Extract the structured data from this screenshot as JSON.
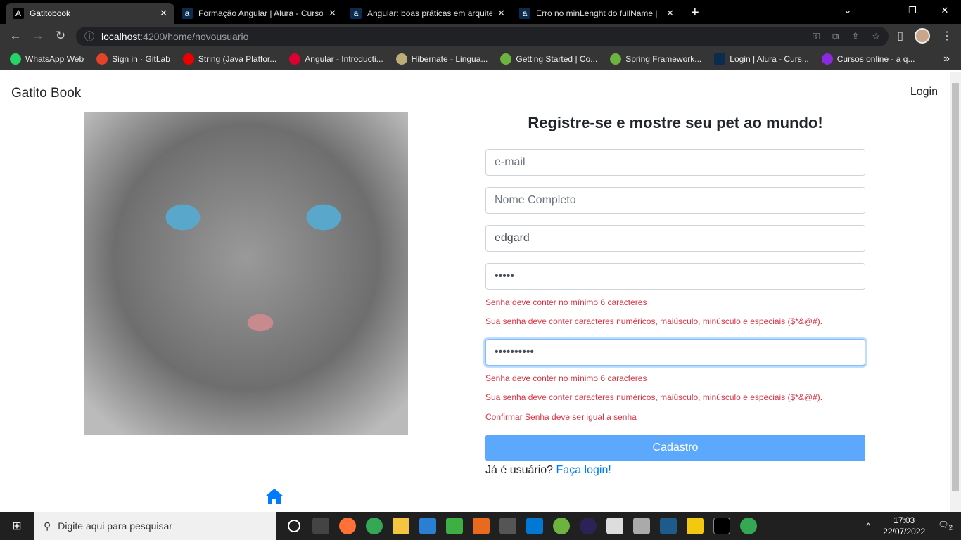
{
  "browser": {
    "tabs": [
      {
        "label": "Gatitobook",
        "active": true
      },
      {
        "label": "Formação Angular | Alura - Cursos"
      },
      {
        "label": "Angular: boas práticas em arquitetura"
      },
      {
        "label": "Erro no minLenght do fullName |"
      }
    ],
    "url_host": "localhost",
    "url_path": ":4200/home/novousuario",
    "bookmarks": [
      {
        "label": "WhatsApp Web",
        "color": "#25d366"
      },
      {
        "label": "Sign in · GitLab",
        "color": "#e24329"
      },
      {
        "label": "String (Java Platfor...",
        "color": "#e00"
      },
      {
        "label": "Angular - Introducti...",
        "color": "#dd0031"
      },
      {
        "label": "Hibernate - Lingua...",
        "color": "#bcae79"
      },
      {
        "label": "Getting Started | Co...",
        "color": "#6db33f"
      },
      {
        "label": "Spring Framework...",
        "color": "#6db33f"
      },
      {
        "label": "Login | Alura - Curs...",
        "color": "#0b2c4e"
      },
      {
        "label": "Cursos online - a q...",
        "color": "#8a2be2"
      }
    ]
  },
  "page": {
    "brand": "Gatito Book",
    "login": "Login",
    "title": "Registre-se e mostre seu pet ao mundo!",
    "fields": {
      "email_placeholder": "e-mail",
      "name_placeholder": "Nome Completo",
      "username": "edgard",
      "password": "•••••",
      "confirm": "••••••••••"
    },
    "errors": {
      "pwd_min": "Senha deve conter no mínimo 6 caracteres",
      "pwd_strength": "Sua senha deve conter caracteres numéricos, maiúsculo, minúsculo e especiais ($*&@#).",
      "confirm_min": "Senha deve conter no mínimo 6 caracteres",
      "confirm_strength": "Sua senha deve conter caracteres numéricos, maiúsculo, minúsculo e especiais ($*&@#).",
      "confirm_match": "Confirmar Senha deve ser igual a senha"
    },
    "submit": "Cadastro",
    "already": "Já é usuário?",
    "login_link": "Faça login!",
    "colors": {
      "error": "#dc3545",
      "button": "#5ba8fc",
      "link": "#007bff"
    }
  },
  "taskbar": {
    "search_placeholder": "Digite aqui para pesquisar",
    "time": "17:03",
    "date": "22/07/2022",
    "notifications": "2"
  }
}
